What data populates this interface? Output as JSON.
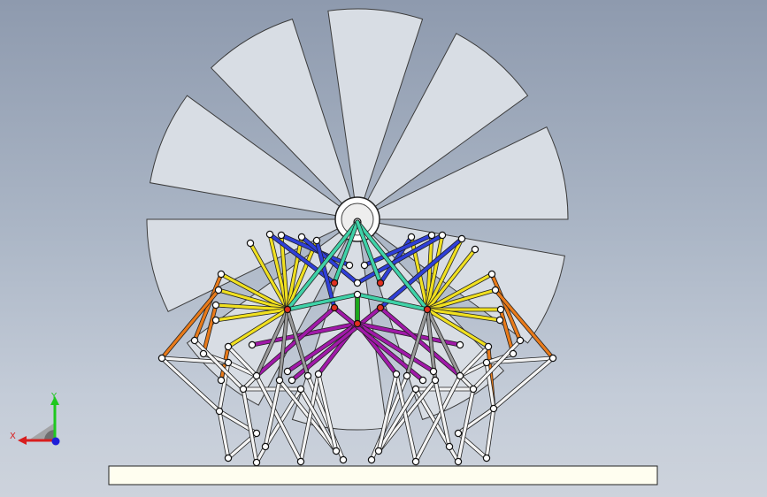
{
  "viewport": {
    "background_top": "#8e9aae",
    "background_bottom": "#cdd3dc"
  },
  "model": {
    "blade_count": 10,
    "blade_fill": "#d8dde4",
    "blade_stroke": "#3c3c3c",
    "link_colors": {
      "white": "#f4f4f4",
      "yellow": "#f0e020",
      "blue": "#2f3fd8",
      "orange": "#e87a1a",
      "magenta": "#a019a8",
      "teal": "#3fd2a8",
      "gray": "#9a9a9a",
      "green": "#1ca81c"
    },
    "joint_fill": "#ffffff",
    "joint_stroke": "#111111",
    "center_joint_fill": "#e03020",
    "base_fill": "#fffef0"
  },
  "triad": {
    "x_label": "X",
    "y_label": "Y",
    "x_color": "#d81e1e",
    "y_color": "#1ec81e",
    "z_color": "#1e1ed8"
  }
}
